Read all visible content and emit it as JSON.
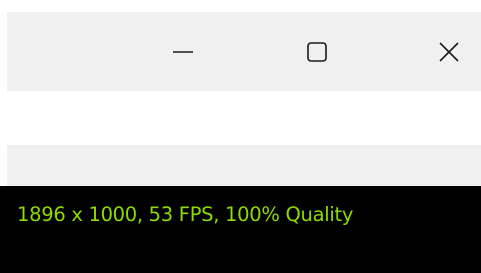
{
  "window": {
    "controls": {
      "minimize_icon": "minimize-icon",
      "maximize_icon": "maximize-icon",
      "close_icon": "close-icon"
    }
  },
  "viewport": {
    "stats_text": "1896 x 1000, 53 FPS, 100% Quality"
  },
  "colors": {
    "titlebar_bg": "#f0f0f0",
    "viewport_bg": "#000000",
    "stats_text": "#8edb00"
  }
}
